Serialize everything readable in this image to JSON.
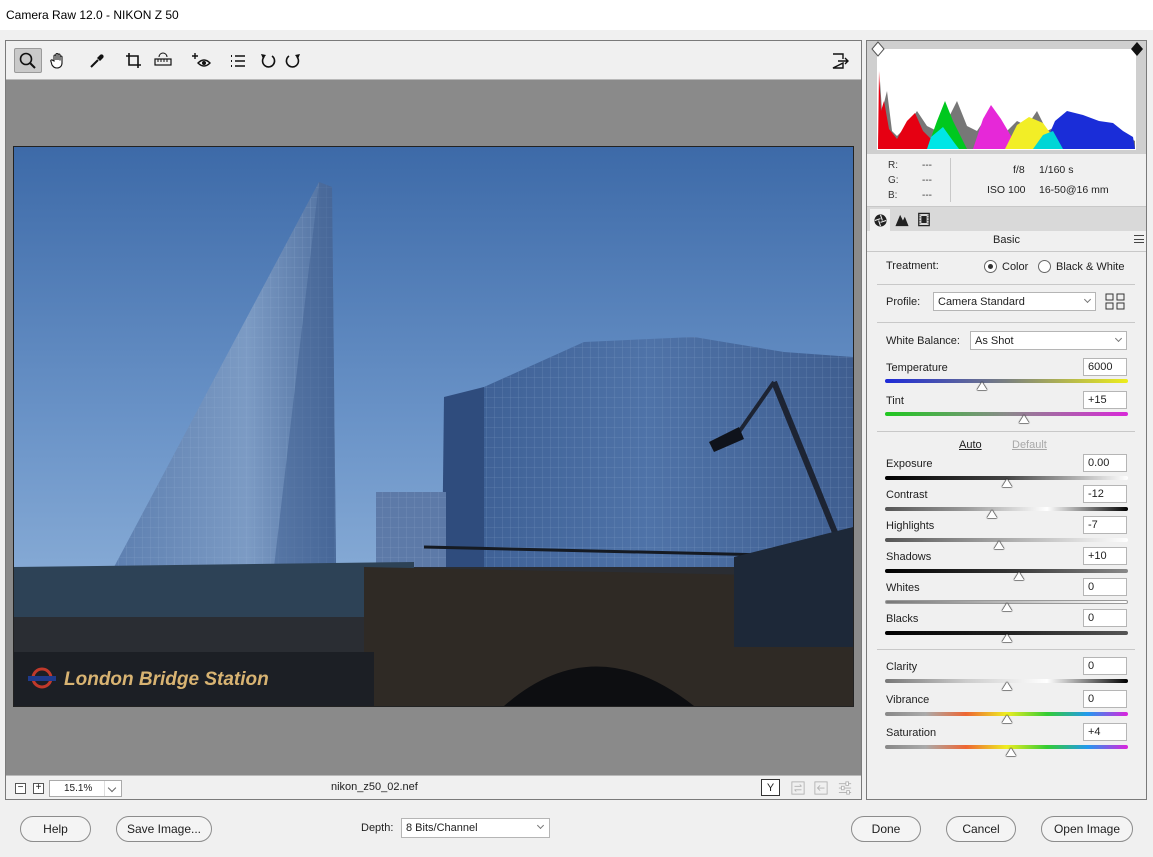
{
  "window": {
    "title": "Camera Raw 12.0  -  NIKON Z 50"
  },
  "toolbar": {
    "tools": [
      "zoom-tool",
      "hand-tool",
      "white-balance-tool",
      "crop-tool",
      "straighten-tool",
      "spot-removal-tool",
      "presets-list",
      "rotate-ccw",
      "rotate-cw"
    ],
    "active_tool": "zoom-tool",
    "toggle_fullscreen_icon": "fullscreen-icon"
  },
  "photo": {
    "caption_sign": "London Bridge Station"
  },
  "statusbar": {
    "zoom_out": "−",
    "zoom_in": "+",
    "zoom_level": "15.1%",
    "filename": "nikon_z50_02.nef",
    "before_after_label": "Y"
  },
  "histogram": {
    "clip_shadow_icon": "shadow-clipping-warning-icon",
    "clip_highlight_icon": "highlight-clipping-warning-icon"
  },
  "readout": {
    "r_label": "R:",
    "r_value": "---",
    "g_label": "G:",
    "g_value": "---",
    "b_label": "B:",
    "b_value": "---",
    "aperture": "f/8",
    "shutter": "1/160 s",
    "iso": "ISO 100",
    "lens": "16-50@16 mm"
  },
  "panel": {
    "title": "Basic",
    "treatment_label": "Treatment:",
    "treatment_options": [
      "Color",
      "Black & White"
    ],
    "treatment_selected": "Color",
    "profile_label": "Profile:",
    "profile_value": "Camera Standard",
    "wb_label": "White Balance:",
    "wb_value": "As Shot",
    "auto_label": "Auto",
    "default_label": "Default",
    "sliders": {
      "temperature": {
        "label": "Temperature",
        "value": "6000",
        "position": 0.4
      },
      "tint": {
        "label": "Tint",
        "value": "+15",
        "position": 0.57
      },
      "exposure": {
        "label": "Exposure",
        "value": "0.00",
        "position": 0.5
      },
      "contrast": {
        "label": "Contrast",
        "value": "-12",
        "position": 0.44
      },
      "highlights": {
        "label": "Highlights",
        "value": "-7",
        "position": 0.47
      },
      "shadows": {
        "label": "Shadows",
        "value": "+10",
        "position": 0.55
      },
      "whites": {
        "label": "Whites",
        "value": "0",
        "position": 0.5
      },
      "blacks": {
        "label": "Blacks",
        "value": "0",
        "position": 0.5
      },
      "clarity": {
        "label": "Clarity",
        "value": "0",
        "position": 0.5
      },
      "vibrance": {
        "label": "Vibrance",
        "value": "0",
        "position": 0.5
      },
      "saturation": {
        "label": "Saturation",
        "value": "+4",
        "position": 0.52
      }
    }
  },
  "footer": {
    "help": "Help",
    "save": "Save Image...",
    "depth_label": "Depth:",
    "depth_value": "8 Bits/Channel",
    "done": "Done",
    "cancel": "Cancel",
    "open": "Open Image"
  }
}
